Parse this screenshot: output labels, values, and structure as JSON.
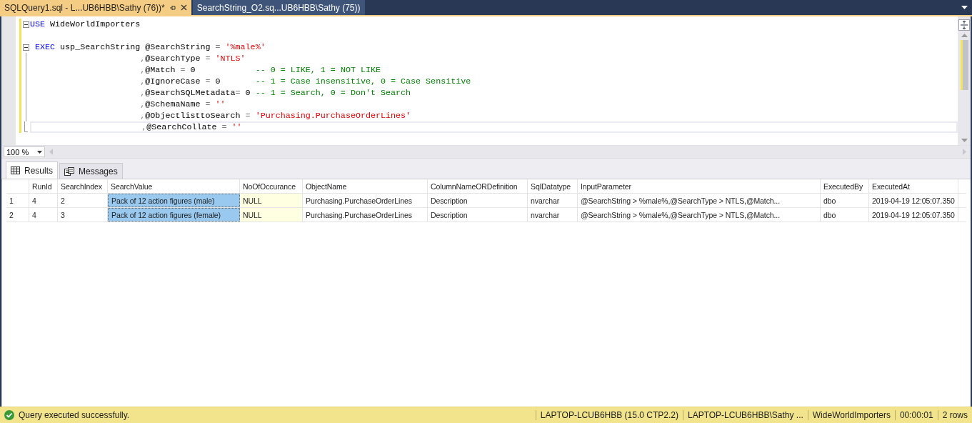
{
  "document_tabs": [
    {
      "label": "SQLQuery1.sql - L...UB6HBB\\Sathy (76))*",
      "selected": true
    },
    {
      "label": "SearchString_O2.sq...UB6HBB\\Sathy (75))",
      "selected": false
    }
  ],
  "editor": {
    "lines": [
      {
        "collapsible": true,
        "current": false,
        "tokens": [
          {
            "kind": "keyword",
            "text": "USE"
          },
          {
            "kind": "text",
            "text": " WideWorldImporters"
          }
        ]
      },
      {
        "collapsible": false,
        "current": false
      },
      {
        "collapsible": true,
        "current": false,
        "tokens": [
          {
            "kind": "keyword",
            "text": " EXEC"
          },
          {
            "kind": "text",
            "text": " usp_SearchString @SearchString "
          },
          {
            "kind": "punct",
            "text": "= "
          },
          {
            "kind": "string",
            "text": "'%male%'"
          }
        ]
      },
      {
        "collapsible": false,
        "current": false,
        "tokens": [
          {
            "kind": "punct",
            "text": "                      ,"
          },
          {
            "kind": "text",
            "text": "@SearchType "
          },
          {
            "kind": "punct",
            "text": "= "
          },
          {
            "kind": "string",
            "text": "'NTLS'"
          }
        ]
      },
      {
        "collapsible": false,
        "current": false,
        "tokens": [
          {
            "kind": "punct",
            "text": "                      ,"
          },
          {
            "kind": "text",
            "text": "@Match "
          },
          {
            "kind": "punct",
            "text": "="
          },
          {
            "kind": "text",
            "text": " 0            "
          },
          {
            "kind": "comment",
            "text": "-- 0 = LIKE, 1 = NOT LIKE"
          }
        ]
      },
      {
        "collapsible": false,
        "current": false,
        "tokens": [
          {
            "kind": "punct",
            "text": "                      ,"
          },
          {
            "kind": "text",
            "text": "@IgnoreCase "
          },
          {
            "kind": "punct",
            "text": "="
          },
          {
            "kind": "text",
            "text": " 0       "
          },
          {
            "kind": "comment",
            "text": "-- 1 = Case insensitive, 0 = Case Sensitive"
          }
        ]
      },
      {
        "collapsible": false,
        "current": false,
        "tokens": [
          {
            "kind": "punct",
            "text": "                      ,"
          },
          {
            "kind": "text",
            "text": "@SearchSQLMetadata"
          },
          {
            "kind": "punct",
            "text": "="
          },
          {
            "kind": "text",
            "text": " 0 "
          },
          {
            "kind": "comment",
            "text": "-- 1 = Search, 0 = Don't Search"
          }
        ]
      },
      {
        "collapsible": false,
        "current": false,
        "tokens": [
          {
            "kind": "punct",
            "text": "                      ,"
          },
          {
            "kind": "text",
            "text": "@SchemaName "
          },
          {
            "kind": "punct",
            "text": "= "
          },
          {
            "kind": "string",
            "text": "''"
          }
        ]
      },
      {
        "collapsible": false,
        "current": false,
        "tokens": [
          {
            "kind": "punct",
            "text": "                      ,"
          },
          {
            "kind": "text",
            "text": "@ObjectlisttoSearch "
          },
          {
            "kind": "punct",
            "text": "= "
          },
          {
            "kind": "string",
            "text": "'Purchasing.PurchaseOrderLines'"
          }
        ]
      },
      {
        "collapsible": false,
        "current": true,
        "tokens": [
          {
            "kind": "punct",
            "text": "                      ,"
          },
          {
            "kind": "text",
            "text": "@SearchCollate "
          },
          {
            "kind": "punct",
            "text": "= "
          },
          {
            "kind": "string",
            "text": "''"
          }
        ]
      }
    ]
  },
  "zoom": {
    "value": "100 %"
  },
  "result_tabs": [
    {
      "label": "Results",
      "kind": "grid",
      "selected": true
    },
    {
      "label": "Messages",
      "kind": "messages",
      "selected": false
    }
  ],
  "table": {
    "columns": [
      "RunId",
      "SearchIndex",
      "SearchValue",
      "NoOfOccurance",
      "ObjectName",
      "ColumnNameORDefinition",
      "SqlDatatype",
      "InputParameter",
      "ExecutedBy",
      "ExecutedAt"
    ],
    "rows": [
      {
        "row_number": "1",
        "cells": [
          {
            "kind": "text",
            "text": "4",
            "selected": false
          },
          {
            "kind": "text",
            "text": "2",
            "selected": false
          },
          {
            "kind": "text",
            "text": "Pack of 12 action figures (male)",
            "selected": true
          },
          {
            "kind": "null",
            "text": "NULL",
            "selected": false
          },
          {
            "kind": "text",
            "text": "Purchasing.PurchaseOrderLines",
            "selected": false
          },
          {
            "kind": "text",
            "text": "Description",
            "selected": false
          },
          {
            "kind": "text",
            "text": "nvarchar",
            "selected": false
          },
          {
            "kind": "text",
            "text": "@SearchString > %male%,@SearchType > NTLS,@Match...",
            "selected": false
          },
          {
            "kind": "text",
            "text": "dbo",
            "selected": false
          },
          {
            "kind": "text",
            "text": "2019-04-19 12:05:07.350",
            "selected": false
          }
        ]
      },
      {
        "row_number": "2",
        "cells": [
          {
            "kind": "text",
            "text": "4",
            "selected": false
          },
          {
            "kind": "text",
            "text": "3",
            "selected": false
          },
          {
            "kind": "text",
            "text": "Pack of 12 action figures (female)",
            "selected": true
          },
          {
            "kind": "null",
            "text": "NULL",
            "selected": false
          },
          {
            "kind": "text",
            "text": "Purchasing.PurchaseOrderLines",
            "selected": false
          },
          {
            "kind": "text",
            "text": "Description",
            "selected": false
          },
          {
            "kind": "text",
            "text": "nvarchar",
            "selected": false
          },
          {
            "kind": "text",
            "text": "@SearchString > %male%,@SearchType > NTLS,@Match...",
            "selected": false
          },
          {
            "kind": "text",
            "text": "dbo",
            "selected": false
          },
          {
            "kind": "text",
            "text": "2019-04-19 12:05:07.350",
            "selected": false
          }
        ]
      }
    ]
  },
  "status_bar": {
    "message": "Query executed successfully.",
    "segments": [
      "LAPTOP-LCUB6HBB (15.0 CTP2.2)",
      "LAPTOP-LCUB6HBB\\Sathy ...",
      "WideWorldImporters",
      "00:00:01",
      "2 rows"
    ]
  }
}
